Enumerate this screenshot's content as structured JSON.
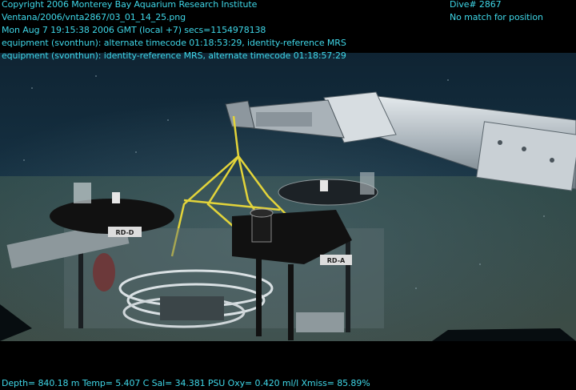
{
  "overlay": {
    "top_left": [
      "Copyright 2006 Monterey Bay Aquarium Research Institute",
      "Ventana/2006/vnta2867/03_01_14_25.png",
      "Mon Aug  7 19:15:38 2006 GMT (local +7)  secs=1154978138",
      "equipment (svonthun): alternate timecode 01:18:53:29, identity-reference MRS",
      "equipment (svonthun): identity-reference MRS, alternate timecode 01:18:57:29"
    ],
    "top_right": [
      "Dive# 2867",
      "No match for position"
    ],
    "bottom": "Depth= 840.18 m  Temp= 5.407 C  Sal= 34.381 PSU  Oxy= 0.420 ml/l  Xmiss= 85.89%"
  },
  "scene": {
    "labels": {
      "left_plate": "RD-D",
      "right_plate": "RD-A"
    },
    "colors": {
      "overlay_text": "#3fd7e8",
      "water": "#132b3c",
      "seafloor": "#3a4a44",
      "arm_metal": "#bfc6cc",
      "rope": "#e8d83a",
      "plate": "#111111"
    }
  }
}
